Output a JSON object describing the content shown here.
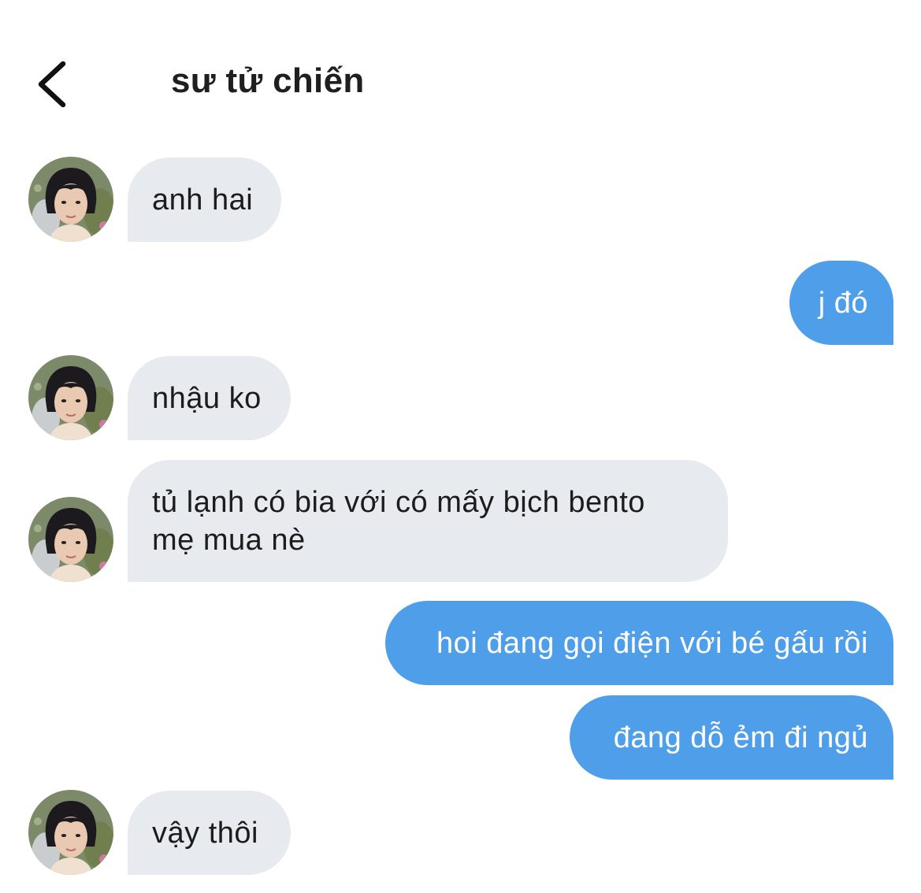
{
  "header": {
    "title": "sư tử chiến",
    "back_icon": "chevron-left-icon"
  },
  "contact": {
    "avatar": "avatar-photo"
  },
  "messages": [
    {
      "from": "them",
      "text": "anh hai"
    },
    {
      "from": "me",
      "text": "j đó"
    },
    {
      "from": "them",
      "text": "nhậu ko"
    },
    {
      "from": "them",
      "lines": [
        "tủ lạnh có bia với có mấy bịch bento",
        "mẹ mua nè"
      ]
    },
    {
      "from": "me",
      "text": "hoi đang gọi điện với bé gấu rồi"
    },
    {
      "from": "me",
      "text": "đang dỗ ẻm đi ngủ"
    },
    {
      "from": "them",
      "text": "vậy thôi"
    }
  ],
  "colors": {
    "incoming_bubble": "#e7ebef",
    "outgoing_bubble": "#4e9ee9",
    "outgoing_text": "#ffffff",
    "title": "#1f1f1f"
  }
}
